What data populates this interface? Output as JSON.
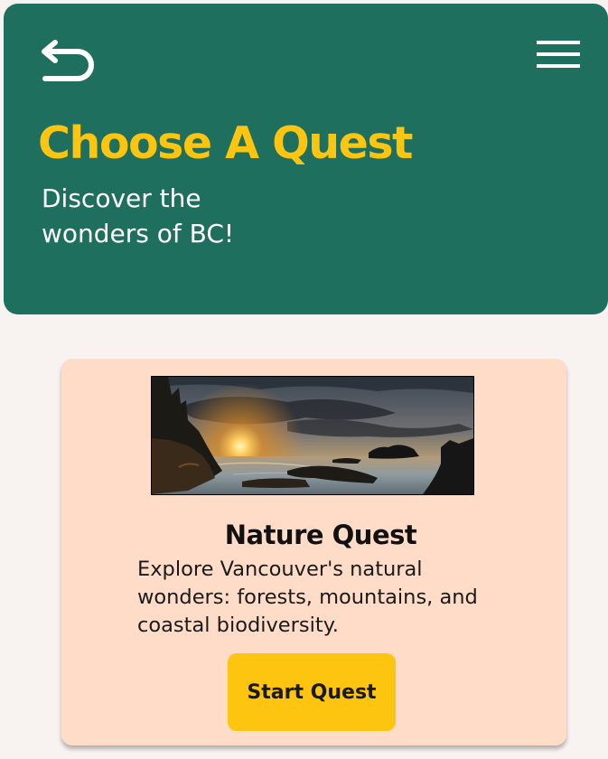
{
  "header": {
    "title": "Choose A Quest",
    "subtitle": "Discover the wonders of BC!",
    "back_icon": "back-arrow-icon",
    "menu_icon": "hamburger-menu-icon"
  },
  "quest_card": {
    "image_alt": "",
    "title": "Nature Quest",
    "description": "Explore Vancouver's natural wonders: forests, mountains, and coastal biodiversity.",
    "button_label": "Start Quest"
  },
  "colors": {
    "header_bg": "#1f6f5f",
    "title_yellow": "#fdc50f",
    "card_bg": "#ffdcc8",
    "page_bg": "#f8f3f0",
    "button_bg": "#fdc50f"
  }
}
